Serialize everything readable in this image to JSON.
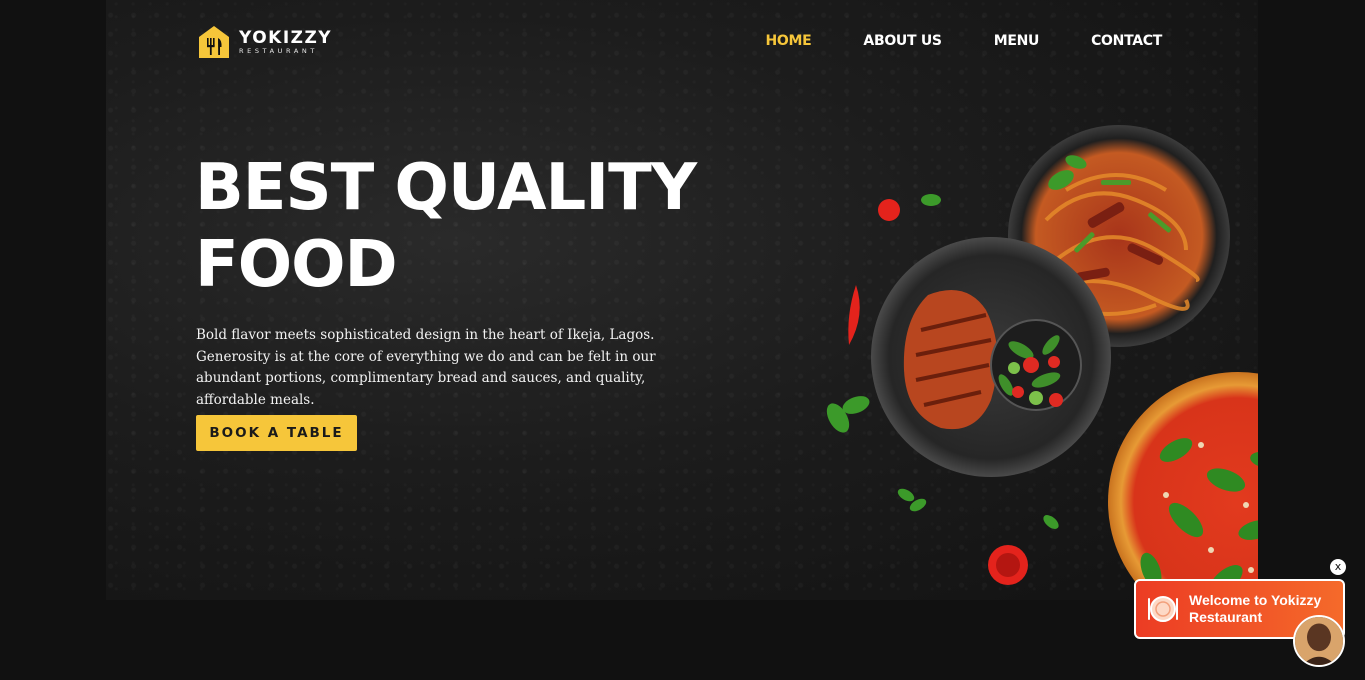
{
  "brand": {
    "name": "YOKIZZY",
    "subtitle": "RESTAURANT",
    "accent_color": "#f6c63a"
  },
  "nav": {
    "items": [
      {
        "label": "HOME",
        "active": true
      },
      {
        "label": "ABOUT US",
        "active": false
      },
      {
        "label": "MENU",
        "active": false
      },
      {
        "label": "CONTACT",
        "active": false
      }
    ]
  },
  "hero": {
    "headline_line1": "BEST QUALITY",
    "headline_line2": "FOOD",
    "description": "Bold flavor meets sophisticated design in the heart of Ikeja, Lagos. Generosity is at the core of everything we do and can be felt in our abundant portions, complimentary bread and sauces, and quality, affordable meals.",
    "cta_label": "BOOK A TABLE",
    "image_icon": "food-dishes-image"
  },
  "chat_widget": {
    "message": "Welcome to Yokizzy Restaurant",
    "close_label": "x",
    "plate_icon": "plate-cutlery-icon",
    "avatar_icon": "agent-avatar"
  }
}
